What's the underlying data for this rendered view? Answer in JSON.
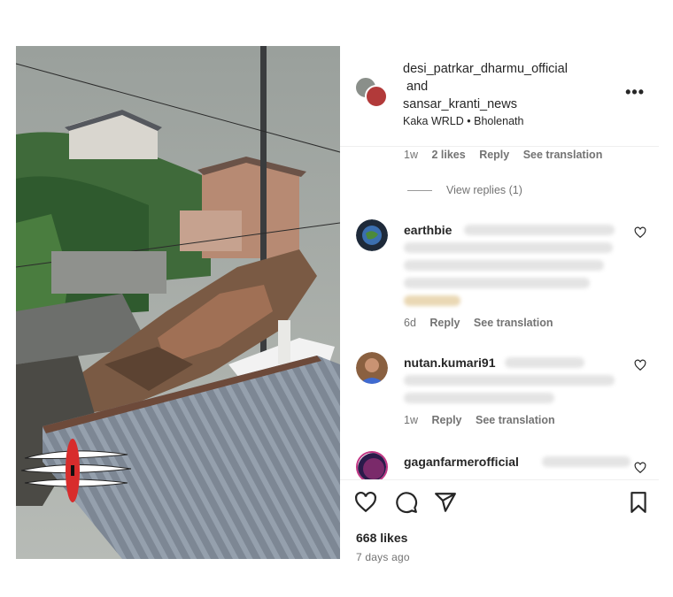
{
  "post": {
    "author_primary": "desi_patrkar_dharmu_official",
    "connector": "and",
    "author_secondary": "sansar_kranti_news",
    "audio": "Kaka WRLD",
    "separator": "•",
    "audio_title": "Bholenath"
  },
  "thread": {
    "reply_meta": {
      "time": "1w",
      "likes": "2 likes",
      "reply": "Reply",
      "translate": "See translation"
    },
    "view_replies": "View replies (1)"
  },
  "comments": [
    {
      "user": "earthbie",
      "time": "6d",
      "reply": "Reply",
      "translate": "See translation"
    },
    {
      "user": "nutan.kumari91",
      "time": "1w",
      "reply": "Reply",
      "translate": "See translation"
    },
    {
      "user": "gaganfarmerofficial"
    }
  ],
  "footer": {
    "likes": "668 likes",
    "posted": "7 days ago"
  },
  "icons": {
    "like": "heart-icon",
    "comment": "comment-icon",
    "share": "send-icon",
    "save": "bookmark-icon",
    "more": "more-icon"
  }
}
